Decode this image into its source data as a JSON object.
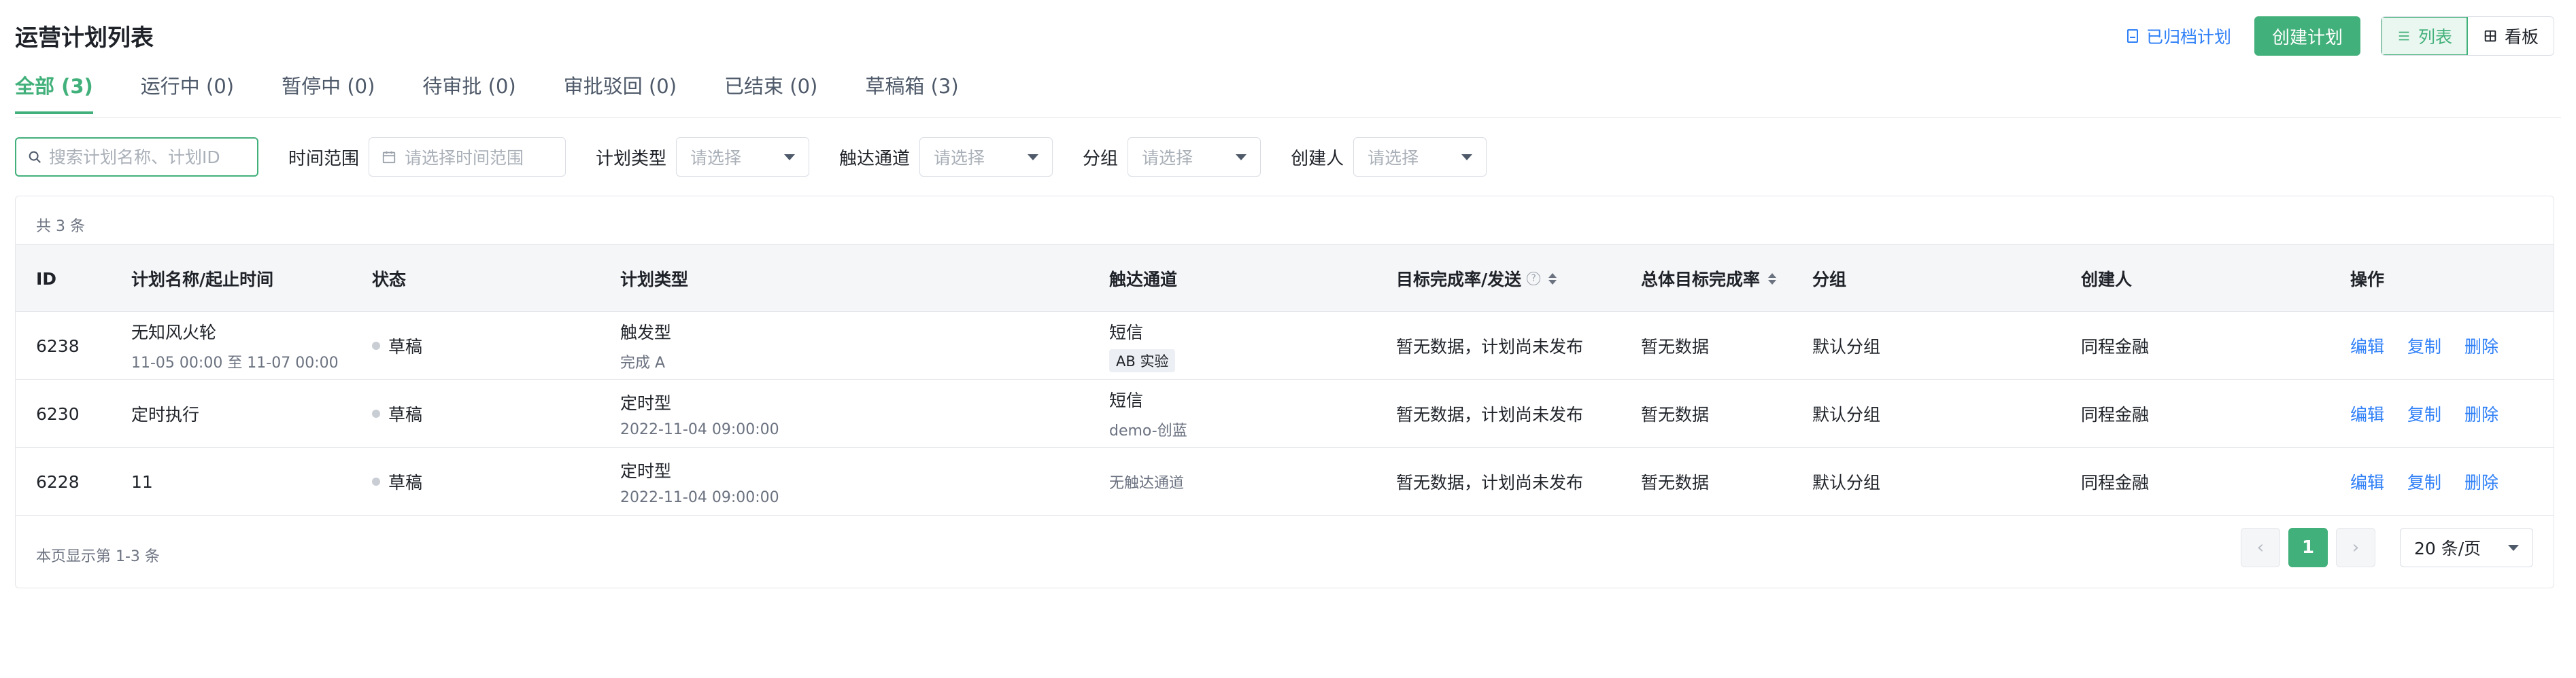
{
  "header": {
    "title": "运营计划列表",
    "archive_label": "已归档计划",
    "create_label": "创建计划",
    "view_list_label": "列表",
    "view_board_label": "看板"
  },
  "tabs": [
    {
      "label": "全部 (3)",
      "active": true
    },
    {
      "label": "运行中 (0)"
    },
    {
      "label": "暂停中 (0)"
    },
    {
      "label": "待审批 (0)"
    },
    {
      "label": "审批驳回 (0)"
    },
    {
      "label": "已结束 (0)"
    },
    {
      "label": "草稿箱 (3)"
    }
  ],
  "filters": {
    "search_placeholder": "搜索计划名称、计划ID",
    "time_label": "时间范围",
    "time_placeholder": "请选择时间范围",
    "type_label": "计划类型",
    "channel_label": "触达通道",
    "group_label": "分组",
    "creator_label": "创建人",
    "select_placeholder": "请选择"
  },
  "table": {
    "total": "共 3 条",
    "columns": {
      "id": "ID",
      "name": "计划名称/起止时间",
      "status": "状态",
      "type": "计划类型",
      "channel": "触达通道",
      "goal_send": "目标完成率/发送",
      "goal_total": "总体目标完成率",
      "group": "分组",
      "creator": "创建人",
      "ops": "操作"
    },
    "rows": [
      {
        "id": "6238",
        "name": "无知风火轮",
        "time": "11-05 00:00 至 11-07 00:00",
        "status": "草稿",
        "type": "触发型",
        "type_sub": "完成 A",
        "channel": "短信",
        "channel_tag": "AB 实验",
        "goal_send": "暂无数据，计划尚未发布",
        "goal_total": "暂无数据",
        "group": "默认分组",
        "creator": "同程金融"
      },
      {
        "id": "6230",
        "name": "定时执行",
        "status": "草稿",
        "type": "定时型",
        "type_sub": "2022-11-04 09:00:00",
        "channel": "短信",
        "channel_sub": "demo-创蓝",
        "goal_send": "暂无数据，计划尚未发布",
        "goal_total": "暂无数据",
        "group": "默认分组",
        "creator": "同程金融"
      },
      {
        "id": "6228",
        "name": "11",
        "status": "草稿",
        "type": "定时型",
        "type_sub": "2022-11-04 09:00:00",
        "channel_muted": "无触达通道",
        "goal_send": "暂无数据，计划尚未发布",
        "goal_total": "暂无数据",
        "group": "默认分组",
        "creator": "同程金融"
      }
    ],
    "ops": {
      "edit": "编辑",
      "copy": "复制",
      "delete": "删除"
    }
  },
  "footer": {
    "info": "本页显示第 1-3 条",
    "current_page": "1",
    "prev": "‹",
    "next": "›",
    "page_size": "20 条/页"
  },
  "colors": {
    "accent": "#42b07a",
    "link": "#2e7ff7"
  }
}
